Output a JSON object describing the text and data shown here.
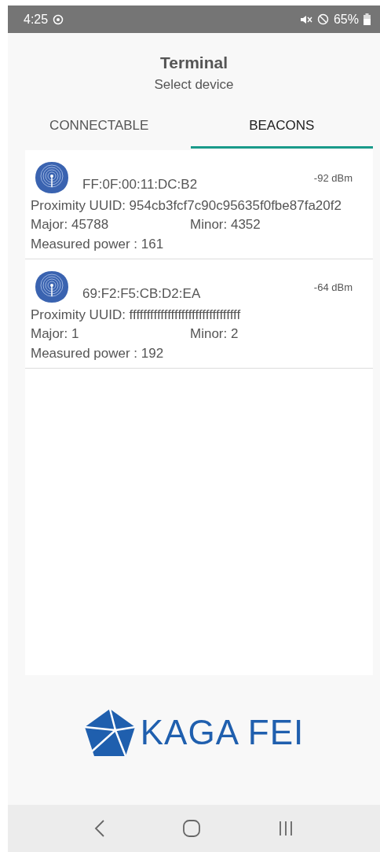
{
  "status_bar": {
    "time": "4:25",
    "battery": "65%"
  },
  "header": {
    "title": "Terminal",
    "subtitle": "Select device"
  },
  "tabs": [
    {
      "label": "CONNECTABLE",
      "selected": false
    },
    {
      "label": "BEACONS",
      "selected": true
    }
  ],
  "beacons": [
    {
      "address": "FF:0F:00:11:DC:B2",
      "rssi": "-92 dBm",
      "uuid": "Proximity UUID: 954cb3fcf7c90c95635f0fbe87fa20f2",
      "major": "Major: 45788",
      "minor": "Minor: 4352",
      "power": "Measured power : 161"
    },
    {
      "address": "69:F2:F5:CB:D2:EA",
      "rssi": "-64 dBm",
      "uuid": "Proximity UUID: ffffffffffffffffffffffffffffffff",
      "major": "Major: 1",
      "minor": "Minor: 2",
      "power": "Measured power : 192"
    }
  ],
  "logo": {
    "text": "KAGA FEI"
  }
}
